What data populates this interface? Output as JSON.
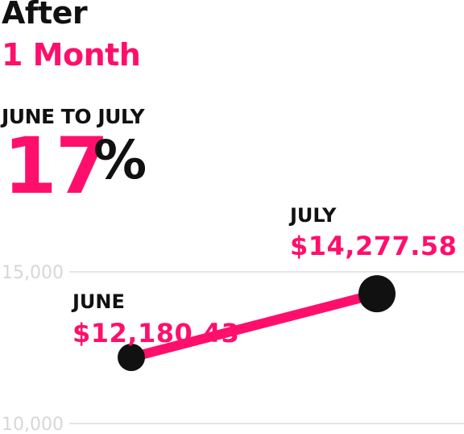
{
  "header": {
    "title_line1": "After",
    "title_line2": "1 Month",
    "range_label": "JUNE TO JULY",
    "percent_value": "17",
    "percent_symbol": "%"
  },
  "points": {
    "june": {
      "label": "JUNE",
      "value_text": "$12,180.43"
    },
    "july": {
      "label": "JULY",
      "value_text": "$14,277.58"
    }
  },
  "colors": {
    "accent": "#ff0f6c",
    "text": "#111111",
    "grid": "#e6e6e6",
    "tick": "#d7d7d7"
  },
  "chart_data": {
    "type": "line",
    "x": [
      "June",
      "July"
    ],
    "series": [
      {
        "values": [
          12180.43,
          14277.58
        ]
      }
    ],
    "yticks": [
      10000,
      15000
    ],
    "ytick_labels": [
      "10,000",
      "15,000"
    ],
    "ylim": [
      10000,
      15000
    ],
    "grid": true,
    "title": "",
    "xlabel": "",
    "ylabel": ""
  }
}
